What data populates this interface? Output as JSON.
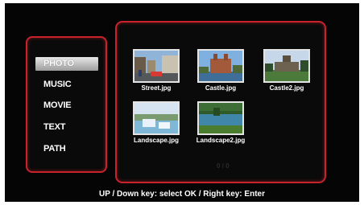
{
  "menu": {
    "items": [
      {
        "label": "PHOTO",
        "selected": true
      },
      {
        "label": "MUSIC",
        "selected": false
      },
      {
        "label": "MOVIE",
        "selected": false
      },
      {
        "label": "TEXT",
        "selected": false
      },
      {
        "label": "PATH",
        "selected": false
      }
    ]
  },
  "files": [
    {
      "name": "Street.jpg",
      "icon": "street-photo-thumbnail"
    },
    {
      "name": "Castle.jpg",
      "icon": "castle-photo-thumbnail"
    },
    {
      "name": "Castle2.jpg",
      "icon": "castle2-photo-thumbnail"
    },
    {
      "name": "Landscape.jpg",
      "icon": "landscape-photo-thumbnail"
    },
    {
      "name": "Landscape2.jpg",
      "icon": "landscape2-photo-thumbnail"
    }
  ],
  "pager": "0 / 0",
  "hint": "UP / Down key: select   OK / Right key: Enter",
  "colors": {
    "accent": "#c8232c",
    "background": "#050505"
  }
}
